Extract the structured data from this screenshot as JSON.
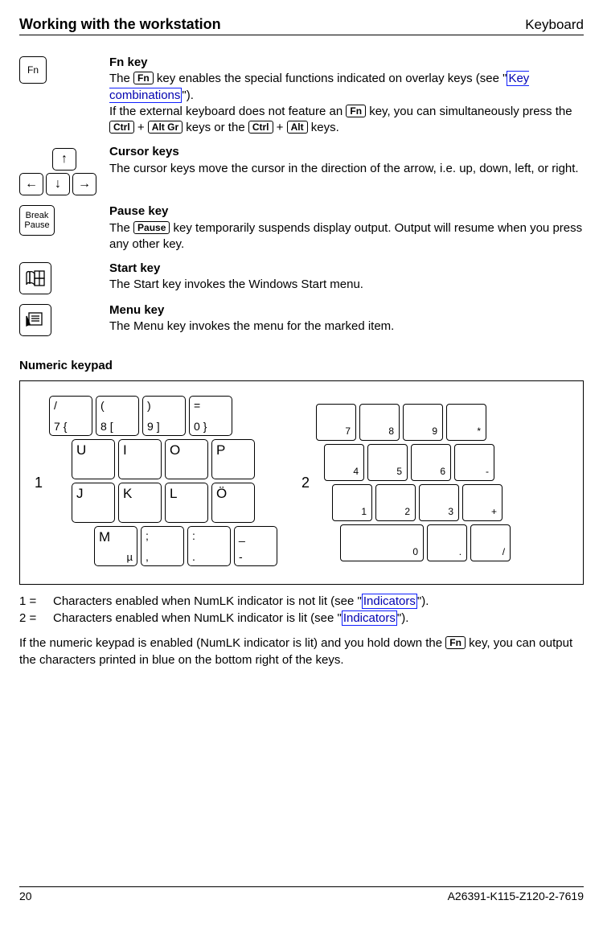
{
  "header": {
    "left": "Working with the workstation",
    "right": "Keyboard"
  },
  "sections": {
    "fn": {
      "title": "Fn key",
      "t1": "The ",
      "k1": "Fn",
      "t2": " key enables the special functions indicated on overlay keys (see \"",
      "link1": "Key combinations",
      "t3": "\").",
      "t4": "If the external keyboard does not feature an ",
      "k2": "Fn",
      "t5": " key, you can simultaneously press the ",
      "k3": "Ctrl",
      "plus": " + ",
      "k4": "Alt Gr",
      "t6": " keys or the ",
      "k5": "Ctrl",
      "k6": "Alt",
      "t7": " keys."
    },
    "cursor": {
      "title": "Cursor keys",
      "body": "The cursor keys move the cursor in the direction of the arrow, i.e. up, down, left, or right."
    },
    "pause": {
      "title": "Pause key",
      "t1": "The ",
      "k1": "Pause",
      "t2": " key temporarily suspends display output. Output will resume when you press any other key.",
      "icon_top": "Break",
      "icon_bot": "Pause"
    },
    "start": {
      "title": "Start key",
      "body": "The Start key invokes the Windows Start menu."
    },
    "menu": {
      "title": "Menu key",
      "body": "The Menu key invokes the menu for the marked item."
    }
  },
  "numeric_title": "Numeric keypad",
  "keypad": {
    "marker1": "1",
    "marker2": "2",
    "left_rows": [
      [
        {
          "top": "/",
          "bot": "7 {"
        },
        {
          "top": "(",
          "bot": "8 ["
        },
        {
          "top": ")",
          "bot": "9 ]"
        },
        {
          "top": "=",
          "bot": "0 }"
        }
      ],
      [
        {
          "single": "U"
        },
        {
          "single": "I"
        },
        {
          "single": "O"
        },
        {
          "single": "P"
        }
      ],
      [
        {
          "single": "J"
        },
        {
          "single": "K"
        },
        {
          "single": "L"
        },
        {
          "single": "Ö"
        }
      ],
      [
        {
          "single": "M",
          "corner": "µ"
        },
        {
          "top": ";",
          "bot": ","
        },
        {
          "top": ":",
          "bot": "."
        },
        {
          "top": "_",
          "bot": "-"
        }
      ]
    ],
    "right_rows": [
      [
        "7",
        "8",
        "9",
        "*"
      ],
      [
        "4",
        "5",
        "6",
        "-"
      ],
      [
        "1",
        "2",
        "3",
        "+"
      ],
      [
        "0",
        "",
        ".",
        "/"
      ]
    ]
  },
  "legend": {
    "l1_lbl": "1 =",
    "l1_t1": "Characters enabled when NumLK indicator is not lit (see \"",
    "l1_link": "Indicators",
    "l1_t2": "\").",
    "l2_lbl": "2 =",
    "l2_t1": "Characters enabled when NumLK indicator is lit (see \"",
    "l2_link": "Indicators",
    "l2_t2": "\")."
  },
  "para": {
    "t1": "If the numeric keypad is enabled (NumLK indicator is lit) and you hold down the ",
    "k1": "Fn",
    "t2": " key, you can output the characters printed in blue on the bottom right of the keys."
  },
  "footer": {
    "page": "20",
    "doc": "A26391-K115-Z120-2-7619"
  },
  "icons": {
    "fn": "Fn"
  }
}
